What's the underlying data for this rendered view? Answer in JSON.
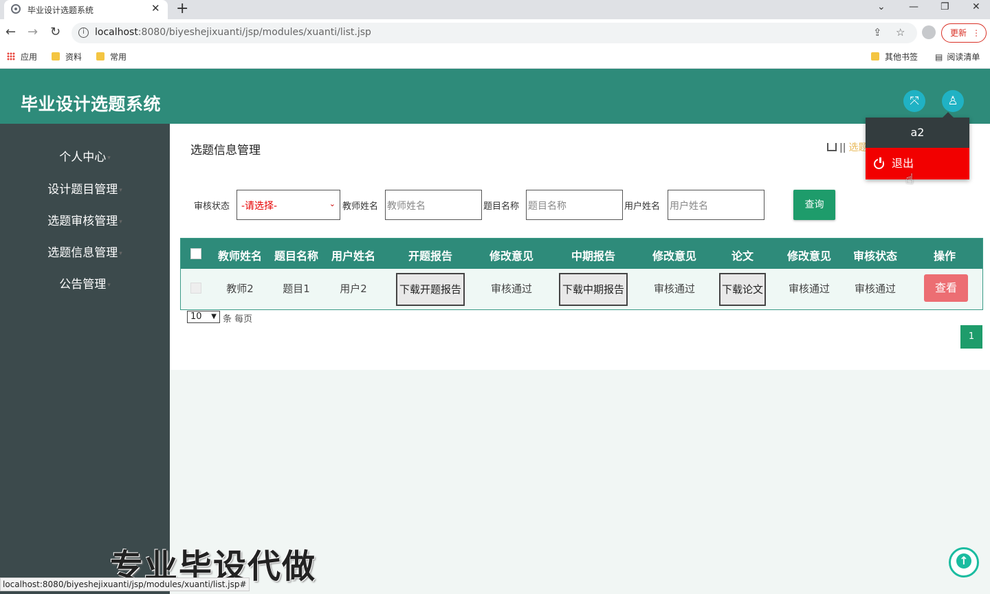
{
  "browser": {
    "tab_title": "毕业设计选题系统",
    "new_tab": "+",
    "url_host": "localhost",
    "url_rest": ":8080/biyeshejixuanti/jsp/modules/xuanti/list.jsp",
    "update_label": "更新",
    "bookmarks": [
      "应用",
      "资料",
      "常用"
    ],
    "bookmarks_right": [
      "其他书签",
      "阅读清单"
    ],
    "status_url": "localhost:8080/biyeshejixuanti/jsp/modules/xuanti/list.jsp#"
  },
  "header": {
    "title": "毕业设计选题系统"
  },
  "user_menu": {
    "username": "a2",
    "logout": "退出"
  },
  "sidebar": {
    "items": [
      {
        "label": "个人中心"
      },
      {
        "label": "设计题目管理"
      },
      {
        "label": "选题审核管理"
      },
      {
        "label": "选题信息管理"
      },
      {
        "label": "公告管理"
      }
    ]
  },
  "page": {
    "title": "选题信息管理",
    "breadcrumb_current": "选题"
  },
  "filters": {
    "status_label": "审核状态",
    "status_value": "-请选择-",
    "teacher_label": "教师姓名",
    "teacher_placeholder": "教师姓名",
    "topic_label": "题目名称",
    "topic_placeholder": "题目名称",
    "user_label": "用户姓名",
    "user_placeholder": "用户姓名",
    "query_button": "查询"
  },
  "table": {
    "headers": [
      "教师姓名",
      "题目名称",
      "用户姓名",
      "开题报告",
      "修改意见",
      "中期报告",
      "修改意见",
      "论文",
      "修改意见",
      "审核状态",
      "操作"
    ],
    "rows": [
      {
        "teacher": "教师2",
        "topic": "题目1",
        "user": "用户2",
        "proposal_btn": "下载开题报告",
        "opinion1": "审核通过",
        "midterm_btn": "下载中期报告",
        "opinion2": "审核通过",
        "thesis_btn": "下载论文",
        "opinion3": "审核通过",
        "status": "审核通过",
        "view_btn": "查看"
      }
    ]
  },
  "pagination": {
    "page_size": "10",
    "page_size_label": "条 每页",
    "current_page": "1"
  },
  "watermark": "专业毕设代做",
  "colors": {
    "header_bg": "#2e8b7a",
    "sidebar_bg": "#3c4a4c",
    "query_btn": "#1e9c6b",
    "view_btn": "#ec6e73",
    "logout_bg": "#f20000"
  }
}
